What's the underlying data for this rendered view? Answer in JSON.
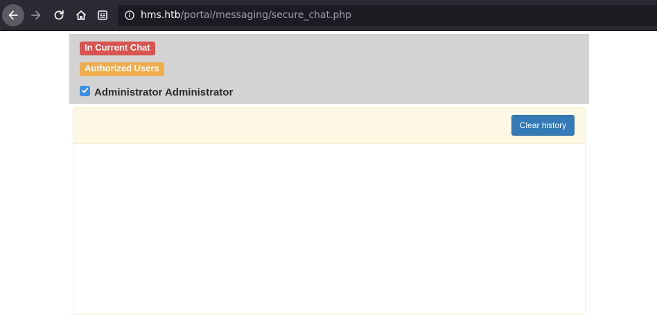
{
  "browser": {
    "url_host": "hms.htb",
    "url_path": "/portal/messaging/secure_chat.php",
    "icons": [
      "back-arrow-icon",
      "forward-arrow-icon",
      "reload-icon",
      "home-icon",
      "reader-view-icon",
      "info-icon"
    ]
  },
  "chat": {
    "in_current_chat_label": "In Current Chat",
    "authorized_users_label": "Authorized Users",
    "users": [
      {
        "name": "Administrator Administrator",
        "checked": true
      }
    ]
  },
  "panel": {
    "clear_history_label": "Clear history"
  },
  "colors": {
    "danger": "#d9534f",
    "warning": "#f0ad4e",
    "primary": "#337ab7",
    "panel_heading_bg": "#fcf8e3",
    "header_bg": "#d3d3d3"
  }
}
